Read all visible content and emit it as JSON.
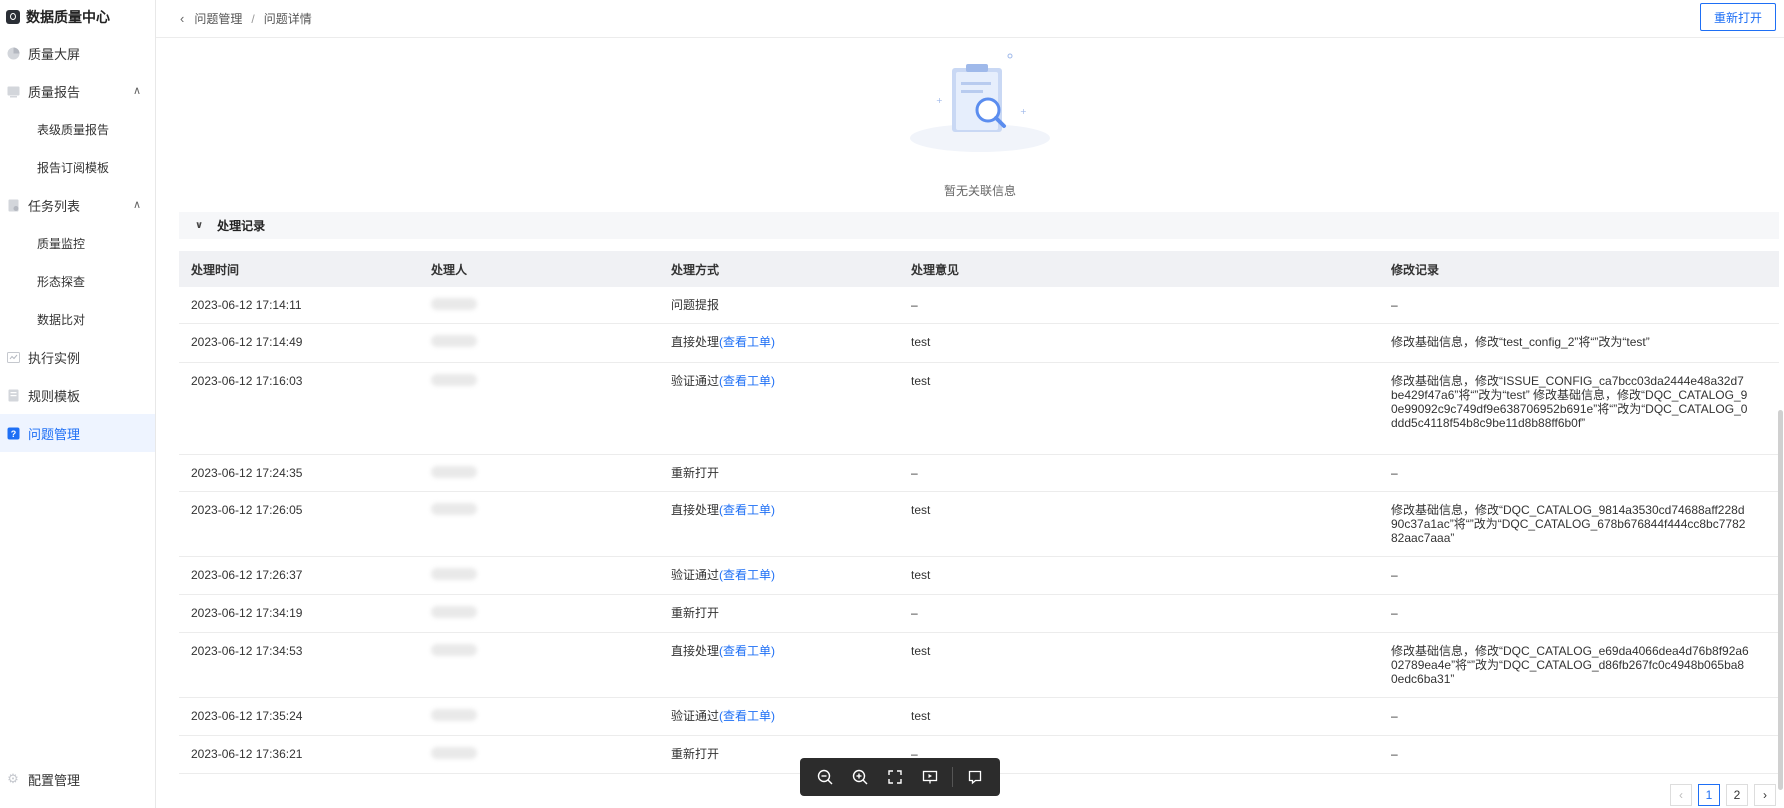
{
  "app": {
    "title": "数据质量中心"
  },
  "sidebar": {
    "items": [
      {
        "label": "质量大屏",
        "icon": "pie-chart-icon"
      },
      {
        "label": "质量报告",
        "icon": "report-icon",
        "expanded": true,
        "children": [
          {
            "label": "表级质量报告"
          },
          {
            "label": "报告订阅模板"
          }
        ]
      },
      {
        "label": "任务列表",
        "icon": "task-icon",
        "expanded": true,
        "children": [
          {
            "label": "质量监控"
          },
          {
            "label": "形态探查"
          },
          {
            "label": "数据比对"
          }
        ]
      },
      {
        "label": "执行实例",
        "icon": "instance-icon"
      },
      {
        "label": "规则模板",
        "icon": "rule-icon"
      },
      {
        "label": "问题管理",
        "icon": "question-icon",
        "active": true
      }
    ],
    "bottom": {
      "label": "配置管理",
      "icon": "gear-icon"
    }
  },
  "header": {
    "breadcrumb": [
      "问题管理",
      "问题详情"
    ],
    "separator": "/",
    "reopen_label": "重新打开"
  },
  "empty": {
    "text": "暂无关联信息"
  },
  "section": {
    "title": "处理记录"
  },
  "table": {
    "columns": [
      "处理时间",
      "处理人",
      "处理方式",
      "处理意见",
      "修改记录"
    ],
    "rows": [
      {
        "time": "2023-06-12 17:14:11",
        "method": "问题提报",
        "link": "",
        "opinion": "–",
        "record": "–"
      },
      {
        "time": "2023-06-12 17:14:49",
        "method": "直接处理",
        "link": "(查看工单)",
        "opinion": "test",
        "record": "修改基础信息，修改“test_config_2”将“”改为“test”"
      },
      {
        "time": "2023-06-12 17:16:03",
        "method": "验证通过",
        "link": "(查看工单)",
        "opinion": "test",
        "record": "修改基础信息，修改“ISSUE_CONFIG_ca7bcc03da2444e48a32d7be429f47a6”将“”改为“test” 修改基础信息，修改“DQC_CATALOG_90e99092c9c749df9e638706952b691e”将“”改为“DQC_CATALOG_0ddd5c4118f54b8c9be11d8b88ff6b0f”"
      },
      {
        "time": "2023-06-12 17:24:35",
        "method": "重新打开",
        "link": "",
        "opinion": "–",
        "record": "–"
      },
      {
        "time": "2023-06-12 17:26:05",
        "method": "直接处理",
        "link": "(查看工单)",
        "opinion": "test",
        "record": "修改基础信息，修改“DQC_CATALOG_9814a3530cd74688aff228d90c37a1ac”将“”改为“DQC_CATALOG_678b676844f444cc8bc778282aac7aaa”"
      },
      {
        "time": "2023-06-12 17:26:37",
        "method": "验证通过",
        "link": "(查看工单)",
        "opinion": "test",
        "record": "–"
      },
      {
        "time": "2023-06-12 17:34:19",
        "method": "重新打开",
        "link": "",
        "opinion": "–",
        "record": "–"
      },
      {
        "time": "2023-06-12 17:34:53",
        "method": "直接处理",
        "link": "(查看工单)",
        "opinion": "test",
        "record": "修改基础信息，修改“DQC_CATALOG_e69da4066dea4d76b8f92a602789ea4e”将“”改为“DQC_CATALOG_d86fb267fc0c4948b065ba80edc6ba31”"
      },
      {
        "time": "2023-06-12 17:35:24",
        "method": "验证通过",
        "link": "(查看工单)",
        "opinion": "test",
        "record": "–"
      },
      {
        "time": "2023-06-12 17:36:21",
        "method": "重新打开",
        "link": "",
        "opinion": "–",
        "record": "–"
      }
    ]
  },
  "pagination": {
    "pages": [
      "1",
      "2"
    ],
    "current": "1",
    "prev": "‹",
    "next": "›"
  },
  "toolbar": {
    "tools": [
      "zoom-out-icon",
      "zoom-in-icon",
      "fullscreen-icon",
      "present-icon",
      "comment-icon"
    ]
  },
  "colors": {
    "accent": "#1e6ff5",
    "active_bg": "#eef4ff"
  }
}
